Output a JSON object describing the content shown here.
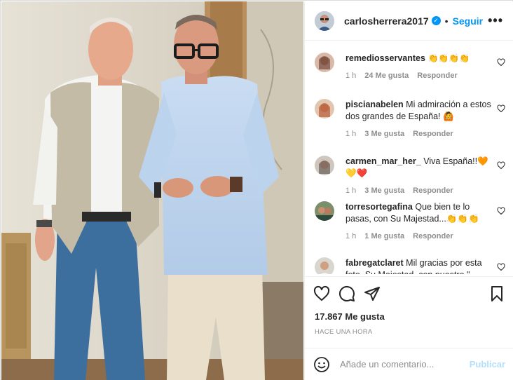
{
  "post": {
    "author": "carlosherrera2017",
    "follow_label": "Seguir",
    "separator": "•",
    "more_label": "•••",
    "verified_glyph": "✓"
  },
  "comments": [
    {
      "user": "remediosservantes",
      "text": "👏👏👏👏",
      "time": "1 h",
      "likes": "24 Me gusta",
      "reply": "Responder"
    },
    {
      "user": "piscianabelen",
      "text": "Mi admiración a estos dos grandes de España! 🙆",
      "time": "1 h",
      "likes": "3 Me gusta",
      "reply": "Responder"
    },
    {
      "user": "carmen_mar_her_",
      "text": "Viva España!!🧡💛❤️",
      "time": "1 h",
      "likes": "3 Me gusta",
      "reply": "Responder"
    },
    {
      "user": "torresortegafina",
      "text": "Que bien te lo pasas, con Su Majestad...👏👏👏",
      "time": "1 h",
      "likes": "1 Me gusta",
      "reply": "Responder"
    },
    {
      "user": "fabregatclaret",
      "text": "Mil gracias por esta foto. Su Majestad, con nuestro \"...",
      "time": "",
      "likes": "",
      "reply": ""
    }
  ],
  "stats": {
    "likes": "17.867 Me gusta",
    "time_ago": "HACE UNA HORA"
  },
  "composer": {
    "placeholder": "Añade un comentario...",
    "publish_label": "Publicar"
  },
  "icons": {
    "like": "heart-icon",
    "comment": "comment-icon",
    "share": "paper-plane-icon",
    "save": "bookmark-icon",
    "emoji": "emoji-icon",
    "more": "more-options-icon"
  },
  "colors": {
    "accent": "#0095f6",
    "publish_disabled": "#b2dffc",
    "muted": "#8e8e8e"
  }
}
